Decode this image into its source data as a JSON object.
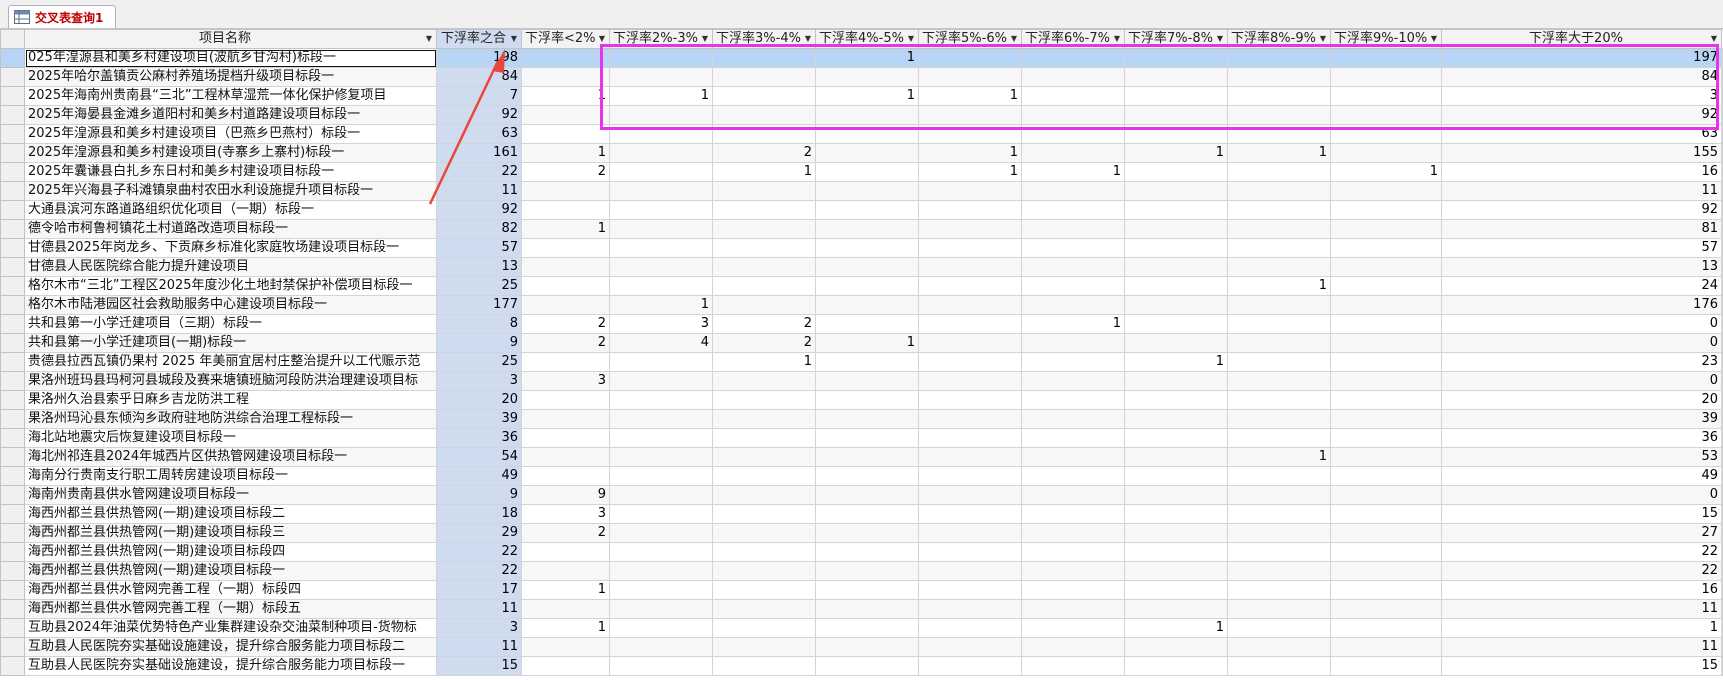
{
  "tab": {
    "label": "交叉表查询1"
  },
  "columns": [
    "项目名称",
    "下浮率之合",
    "下浮率<2%",
    "下浮率2%-3%",
    "下浮率3%-4%",
    "下浮率4%-5%",
    "下浮率5%-6%",
    "下浮率6%-7%",
    "下浮率7%-8%",
    "下浮率8%-9%",
    "下浮率9%-10%",
    "下浮率大于20%"
  ],
  "rows": [
    [
      "025年湟源县和美乡村建设项目(波航乡甘沟村)标段一",
      "198",
      "",
      "",
      "",
      "1",
      "",
      "",
      "",
      "",
      "",
      "197"
    ],
    [
      "2025年哈尔盖镇贡公麻村养殖场提档升级项目标段一",
      "84",
      "",
      "",
      "",
      "",
      "",
      "",
      "",
      "",
      "",
      "84"
    ],
    [
      "2025年海南州贵南县“三北”工程林草湿荒一体化保护修复项目",
      "7",
      "1",
      "1",
      "",
      "1",
      "1",
      "",
      "",
      "",
      "",
      "3"
    ],
    [
      "2025年海晏县金滩乡道阳村和美乡村道路建设项目标段一",
      "92",
      "",
      "",
      "",
      "",
      "",
      "",
      "",
      "",
      "",
      "92"
    ],
    [
      "2025年湟源县和美乡村建设项目（巴燕乡巴燕村）标段一",
      "63",
      "",
      "",
      "",
      "",
      "",
      "",
      "",
      "",
      "",
      "63"
    ],
    [
      "2025年湟源县和美乡村建设项目(寺寨乡上寨村)标段一",
      "161",
      "1",
      "",
      "2",
      "",
      "1",
      "",
      "1",
      "1",
      "",
      "155"
    ],
    [
      "2025年囊谦县白扎乡东日村和美乡村建设项目标段一",
      "22",
      "2",
      "",
      "1",
      "",
      "1",
      "1",
      "",
      "",
      "1",
      "16"
    ],
    [
      "2025年兴海县子科滩镇泉曲村农田水利设施提升项目标段一",
      "11",
      "",
      "",
      "",
      "",
      "",
      "",
      "",
      "",
      "",
      "11"
    ],
    [
      "大通县滨河东路道路组织优化项目（一期）标段一",
      "92",
      "",
      "",
      "",
      "",
      "",
      "",
      "",
      "",
      "",
      "92"
    ],
    [
      "德令哈市柯鲁柯镇花土村道路改造项目标段一",
      "82",
      "1",
      "",
      "",
      "",
      "",
      "",
      "",
      "",
      "",
      "81"
    ],
    [
      "甘德县2025年岗龙乡、下贡麻乡标准化家庭牧场建设项目标段一",
      "57",
      "",
      "",
      "",
      "",
      "",
      "",
      "",
      "",
      "",
      "57"
    ],
    [
      "甘德县人民医院综合能力提升建设项目",
      "13",
      "",
      "",
      "",
      "",
      "",
      "",
      "",
      "",
      "",
      "13"
    ],
    [
      "格尔木市“三北”工程区2025年度沙化土地封禁保护补偿项目标段一",
      "25",
      "",
      "",
      "",
      "",
      "",
      "",
      "",
      "1",
      "",
      "24"
    ],
    [
      "格尔木市陆港园区社会救助服务中心建设项目标段一",
      "177",
      "",
      "1",
      "",
      "",
      "",
      "",
      "",
      "",
      "",
      "176"
    ],
    [
      "共和县第一小学迁建项目（三期）标段一",
      "8",
      "2",
      "3",
      "2",
      "",
      "",
      "1",
      "",
      "",
      "",
      "0"
    ],
    [
      "共和县第一小学迁建项目(一期)标段一",
      "9",
      "2",
      "4",
      "2",
      "1",
      "",
      "",
      "",
      "",
      "",
      "0"
    ],
    [
      "贵德县拉西瓦镇仍果村 2025 年美丽宜居村庄整治提升以工代赈示范",
      "25",
      "",
      "",
      "1",
      "",
      "",
      "",
      "1",
      "",
      "",
      "23"
    ],
    [
      "果洛州班玛县玛柯河县城段及赛来塘镇班脑河段防洪治理建设项目标",
      "3",
      "3",
      "",
      "",
      "",
      "",
      "",
      "",
      "",
      "",
      "0"
    ],
    [
      "果洛州久治县索乎日麻乡吉龙防洪工程",
      "20",
      "",
      "",
      "",
      "",
      "",
      "",
      "",
      "",
      "",
      "20"
    ],
    [
      "果洛州玛沁县东倾沟乡政府驻地防洪综合治理工程标段一",
      "39",
      "",
      "",
      "",
      "",
      "",
      "",
      "",
      "",
      "",
      "39"
    ],
    [
      "海北站地震灾后恢复建设项目标段一",
      "36",
      "",
      "",
      "",
      "",
      "",
      "",
      "",
      "",
      "",
      "36"
    ],
    [
      "海北州祁连县2024年城西片区供热管网建设项目标段一",
      "54",
      "",
      "",
      "",
      "",
      "",
      "",
      "",
      "1",
      "",
      "53"
    ],
    [
      "海南分行贵南支行职工周转房建设项目标段一",
      "49",
      "",
      "",
      "",
      "",
      "",
      "",
      "",
      "",
      "",
      "49"
    ],
    [
      "海南州贵南县供水管网建设项目标段一",
      "9",
      "9",
      "",
      "",
      "",
      "",
      "",
      "",
      "",
      "",
      "0"
    ],
    [
      "海西州都兰县供热管网(一期)建设项目标段二",
      "18",
      "3",
      "",
      "",
      "",
      "",
      "",
      "",
      "",
      "",
      "15"
    ],
    [
      "海西州都兰县供热管网(一期)建设项目标段三",
      "29",
      "2",
      "",
      "",
      "",
      "",
      "",
      "",
      "",
      "",
      "27"
    ],
    [
      "海西州都兰县供热管网(一期)建设项目标段四",
      "22",
      "",
      "",
      "",
      "",
      "",
      "",
      "",
      "",
      "",
      "22"
    ],
    [
      "海西州都兰县供热管网(一期)建设项目标段一",
      "22",
      "",
      "",
      "",
      "",
      "",
      "",
      "",
      "",
      "",
      "22"
    ],
    [
      "海西州都兰县供水管网完善工程（一期）标段四",
      "17",
      "1",
      "",
      "",
      "",
      "",
      "",
      "",
      "",
      "",
      "16"
    ],
    [
      "海西州都兰县供水管网完善工程（一期）标段五",
      "11",
      "",
      "",
      "",
      "",
      "",
      "",
      "",
      "",
      "",
      "11"
    ],
    [
      "互助县2024年油菜优势特色产业集群建设杂交油菜制种项目-货物标",
      "3",
      "1",
      "",
      "",
      "",
      "",
      "",
      "1",
      "",
      "",
      "1"
    ],
    [
      "互助县人民医院夯实基础设施建设，提升综合服务能力项目标段二",
      "11",
      "",
      "",
      "",
      "",
      "",
      "",
      "",
      "",
      "",
      "11"
    ],
    [
      "互助县人民医院夯实基础设施建设，提升综合服务能力项目标段一",
      "15",
      "",
      "",
      "",
      "",
      "",
      "",
      "",
      "",
      "",
      "15"
    ]
  ],
  "colors": {
    "tab_label": "#c00000",
    "highlight_box": "#e834e8",
    "arrow": "#e8473d",
    "row_highlight": "#b9d5f5"
  }
}
